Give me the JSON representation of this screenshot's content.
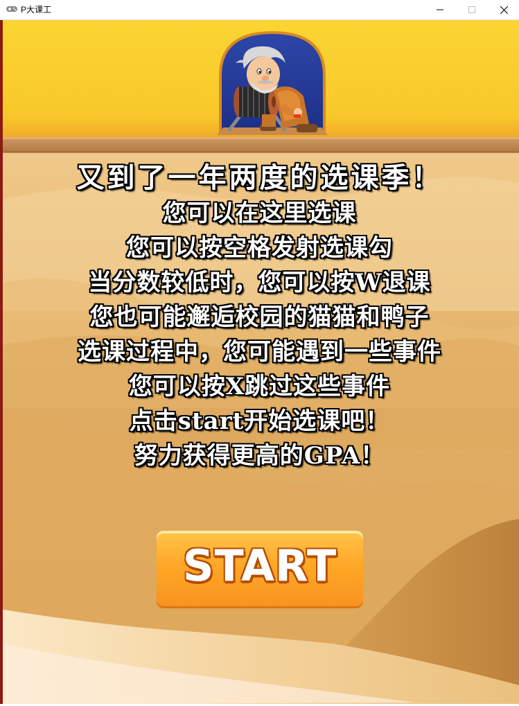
{
  "window": {
    "title": "P大课工",
    "controls": {
      "minimize": "minimize-icon",
      "maximize": "maximize-icon",
      "close": "close-icon"
    }
  },
  "game": {
    "instructions": [
      "又到了一年两度的选课季！",
      "您可以在这里选课",
      "您可以按空格发射选课勾",
      "当分数较低时，您可以按W退课",
      "您也可能邂逅校园的猫猫和鸭子",
      "选课过程中，您可能遇到一些事件",
      "您可以按X跳过这些事件",
      "点击start开始选课吧！",
      "努力获得更高的GPA！"
    ],
    "start_label": "START",
    "colors": {
      "sky": "#f9d130",
      "plank": "#c48a52",
      "sand_light": "#f7dcaa",
      "sand_dark": "#c9934c",
      "button": "#ffa726",
      "left_edge": "#8b1a12"
    }
  }
}
